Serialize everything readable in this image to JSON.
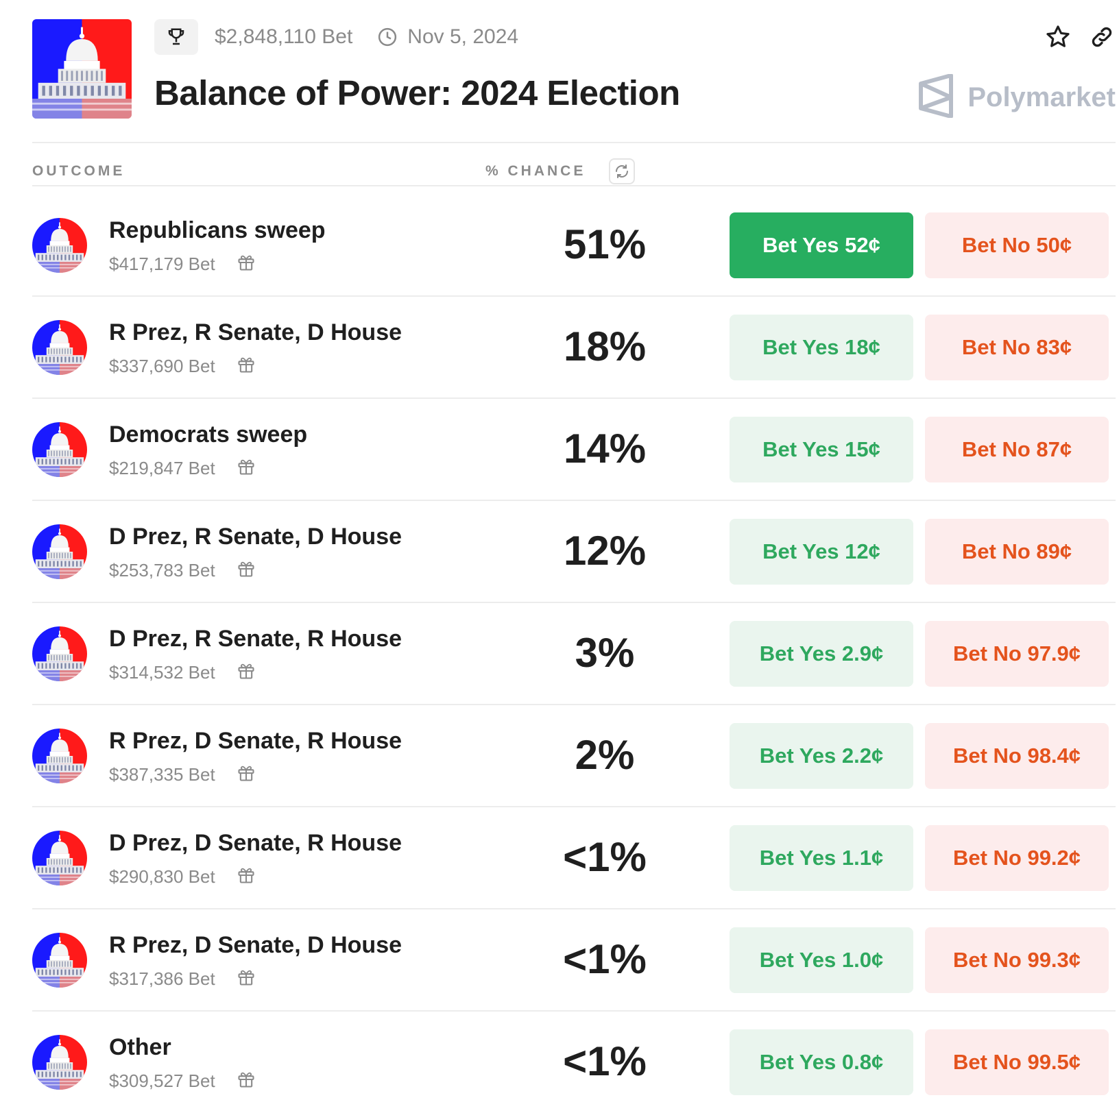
{
  "header": {
    "volume": "$2,848,110 Bet",
    "date": "Nov 5, 2024",
    "title": "Balance of Power: 2024 Election",
    "brand": "Polymarket"
  },
  "columns": {
    "outcome": "OUTCOME",
    "chance": "% CHANCE"
  },
  "colors": {
    "yes_active": "#27ae60",
    "yes_text": "#2ea85e",
    "no_text": "#e4531d",
    "republican_red": "#ff1a1a",
    "democrat_blue": "#1a1aff"
  },
  "outcomes": [
    {
      "name": "Republicans sweep",
      "volume": "$417,179 Bet",
      "chance": "51%",
      "yes": "Bet Yes 52¢",
      "no": "Bet No 50¢"
    },
    {
      "name": "R Prez, R Senate, D House",
      "volume": "$337,690 Bet",
      "chance": "18%",
      "yes": "Bet Yes 18¢",
      "no": "Bet No 83¢"
    },
    {
      "name": "Democrats sweep",
      "volume": "$219,847 Bet",
      "chance": "14%",
      "yes": "Bet Yes 15¢",
      "no": "Bet No 87¢"
    },
    {
      "name": "D Prez, R Senate, D House",
      "volume": "$253,783 Bet",
      "chance": "12%",
      "yes": "Bet Yes 12¢",
      "no": "Bet No 89¢"
    },
    {
      "name": "D Prez, R Senate, R House",
      "volume": "$314,532 Bet",
      "chance": "3%",
      "yes": "Bet Yes 2.9¢",
      "no": "Bet No 97.9¢"
    },
    {
      "name": "R Prez, D Senate, R House",
      "volume": "$387,335 Bet",
      "chance": "2%",
      "yes": "Bet Yes 2.2¢",
      "no": "Bet No 98.4¢"
    },
    {
      "name": "D Prez, D Senate, R House",
      "volume": "$290,830 Bet",
      "chance": "<1%",
      "yes": "Bet Yes 1.1¢",
      "no": "Bet No 99.2¢"
    },
    {
      "name": "R Prez, D Senate, D House",
      "volume": "$317,386 Bet",
      "chance": "<1%",
      "yes": "Bet Yes 1.0¢",
      "no": "Bet No 99.3¢"
    },
    {
      "name": "Other",
      "volume": "$309,527 Bet",
      "chance": "<1%",
      "yes": "Bet Yes 0.8¢",
      "no": "Bet No 99.5¢"
    }
  ]
}
